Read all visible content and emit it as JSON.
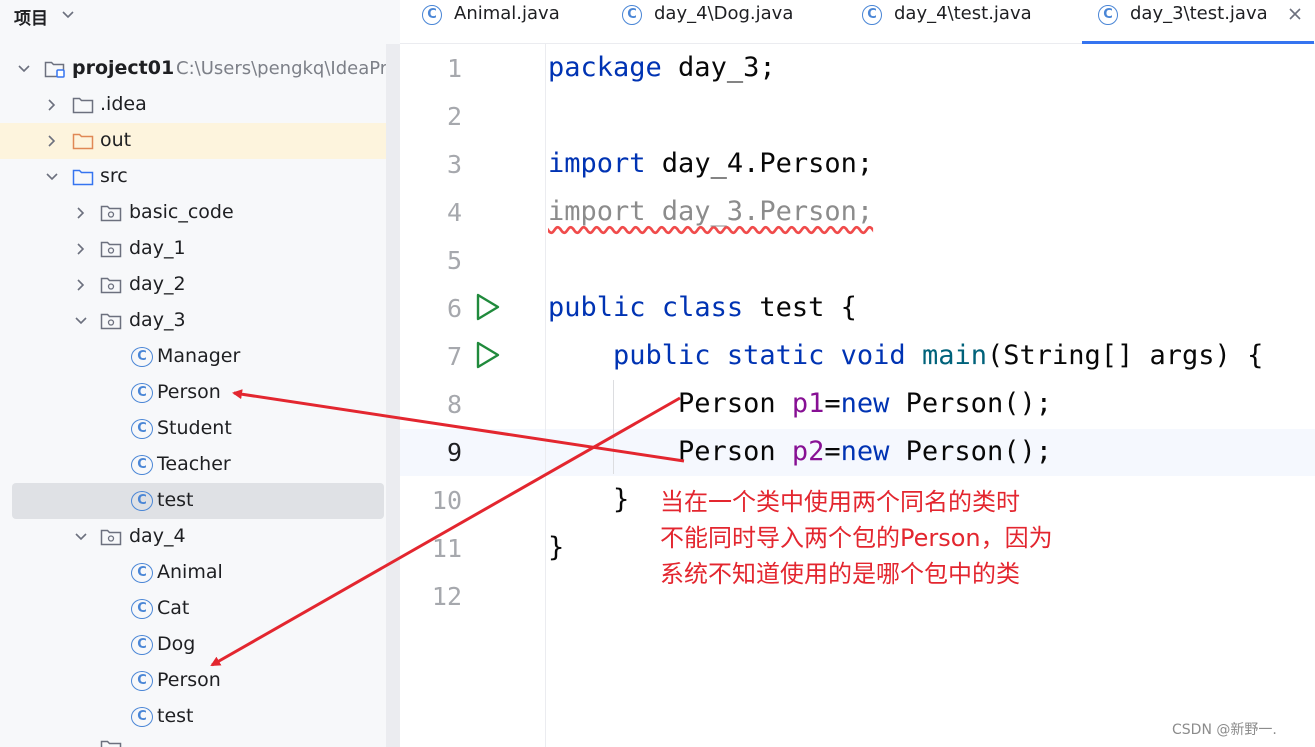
{
  "project_panel": {
    "title": "项目",
    "title_icon": "chevron-down-icon",
    "project": {
      "name": "project01",
      "path": "C:\\Users\\pengkq\\IdeaPro"
    },
    "folders": {
      "idea": ".idea",
      "out": "out",
      "src": "src",
      "basic_code": "basic_code",
      "day_1": "day_1",
      "day_2": "day_2",
      "day_3": "day_3",
      "day_4": "day_4"
    },
    "day_3_classes": [
      "Manager",
      "Person",
      "Student",
      "Teacher",
      "test"
    ],
    "day_4_classes": [
      "Animal",
      "Cat",
      "Dog",
      "Person",
      "test"
    ],
    "selected_item": "test",
    "class_icon_letter": "C"
  },
  "tabs": [
    {
      "label": "Animal.java",
      "active": false
    },
    {
      "label": "day_4\\Dog.java",
      "active": false
    },
    {
      "label": "day_4\\test.java",
      "active": false
    },
    {
      "label": "day_3\\test.java",
      "active": true
    }
  ],
  "editor": {
    "line_numbers": [
      "1",
      "2",
      "3",
      "4",
      "5",
      "6",
      "7",
      "8",
      "9",
      "10",
      "11",
      "12"
    ],
    "current_line": 9,
    "code": {
      "l1_kw": "package",
      "l1_rest": " day_3;",
      "l3_kw": "import",
      "l3_rest": " day_4.Person;",
      "l4_unused": "import day_3.Person;",
      "l6_kw1": "public",
      "l6_kw2": "class",
      "l6_rest": " test {",
      "l7_kw1": "public",
      "l7_kw2": "static",
      "l7_kw3": "void",
      "l7_fn": "main",
      "l7_rest": "(String[] args) {",
      "l8_type": "Person ",
      "l8_var": "p1",
      "l8_eq": "=",
      "l8_new": "new",
      "l8_rest": " Person();",
      "l9_type": "Person ",
      "l9_var": "p2",
      "l9_eq": "=",
      "l9_new": "new",
      "l9_rest": " Person();",
      "l10": "}",
      "l11": "}"
    },
    "annotation": [
      "当在一个类中使用两个同名的类时",
      "不能同时导入两个包的Person，因为",
      "系统不知道使用的是哪个包中的类"
    ]
  },
  "watermark": "CSDN @新野一.",
  "colors": {
    "keyword": "#0033b3",
    "function": "#00627a",
    "variable": "#871094",
    "annotation_red": "#e3262f",
    "selection": "#dfe1e5",
    "folder_highlight": "#fdf4dd",
    "tab_underline": "#3574f0"
  }
}
